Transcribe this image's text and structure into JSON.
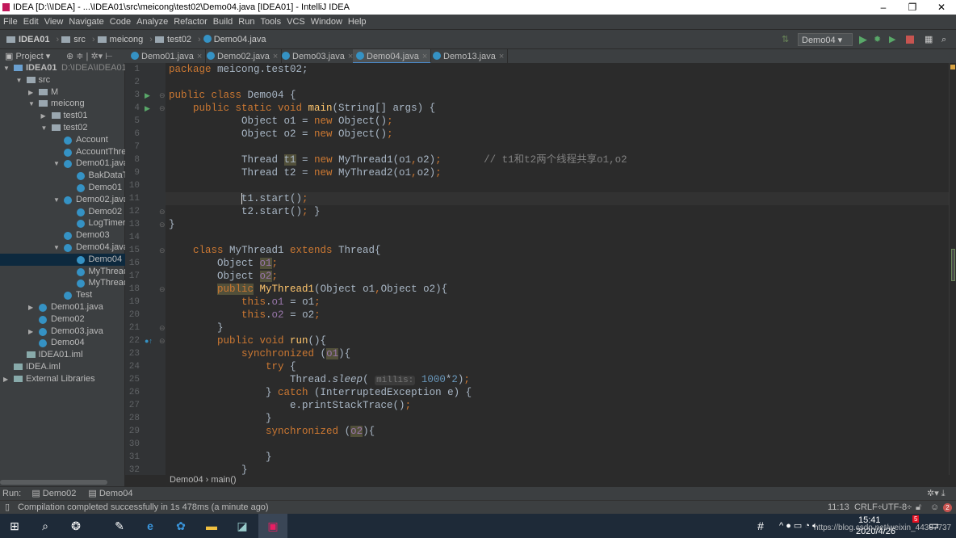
{
  "window": {
    "title": "IDEA [D:\\\\IDEA] - ...\\IDEA01\\src\\meicong\\test02\\Demo04.java [IDEA01] - IntelliJ IDEA"
  },
  "menu": [
    "File",
    "Edit",
    "View",
    "Navigate",
    "Code",
    "Analyze",
    "Refactor",
    "Build",
    "Run",
    "Tools",
    "VCS",
    "Window",
    "Help"
  ],
  "breadcrumb": [
    "IDEA01",
    "src",
    "meicong",
    "test02",
    "Demo04.java"
  ],
  "run_config": "Demo04",
  "project_label": "Project",
  "tabs": [
    {
      "label": "Demo01.java"
    },
    {
      "label": "Demo02.java"
    },
    {
      "label": "Demo03.java"
    },
    {
      "label": "Demo04.java",
      "active": true
    },
    {
      "label": "Demo13.java"
    }
  ],
  "tree": [
    {
      "d": 0,
      "label": "IDEA01",
      "extra": "D:\\IDEA\\IDEA01",
      "arrow": "open",
      "icon": "module"
    },
    {
      "d": 1,
      "label": "src",
      "arrow": "open",
      "icon": "folder"
    },
    {
      "d": 2,
      "label": "M",
      "arrow": "closed",
      "icon": "folder"
    },
    {
      "d": 2,
      "label": "meicong",
      "arrow": "open",
      "icon": "folder"
    },
    {
      "d": 3,
      "label": "test01",
      "arrow": "closed",
      "icon": "folder"
    },
    {
      "d": 3,
      "label": "test02",
      "arrow": "open",
      "icon": "folder"
    },
    {
      "d": 4,
      "label": "Account",
      "icon": "class"
    },
    {
      "d": 4,
      "label": "AccountThrea",
      "icon": "class"
    },
    {
      "d": 4,
      "label": "Demo01.java",
      "arrow": "open",
      "icon": "class"
    },
    {
      "d": 5,
      "label": "BakDataTh",
      "icon": "class"
    },
    {
      "d": 5,
      "label": "Demo01",
      "icon": "class"
    },
    {
      "d": 4,
      "label": "Demo02.java",
      "arrow": "open",
      "icon": "class"
    },
    {
      "d": 5,
      "label": "Demo02",
      "icon": "class"
    },
    {
      "d": 5,
      "label": "LogTimer",
      "icon": "class"
    },
    {
      "d": 4,
      "label": "Demo03",
      "icon": "class"
    },
    {
      "d": 4,
      "label": "Demo04.java",
      "arrow": "open",
      "icon": "class"
    },
    {
      "d": 5,
      "label": "Demo04",
      "icon": "class",
      "selected": true
    },
    {
      "d": 5,
      "label": "MyThread",
      "icon": "class"
    },
    {
      "d": 5,
      "label": "MyThread",
      "icon": "class"
    },
    {
      "d": 4,
      "label": "Test",
      "icon": "class"
    },
    {
      "d": 2,
      "label": "Demo01.java",
      "arrow": "closed",
      "icon": "class"
    },
    {
      "d": 2,
      "label": "Demo02",
      "icon": "class"
    },
    {
      "d": 2,
      "label": "Demo03.java",
      "arrow": "closed",
      "icon": "class"
    },
    {
      "d": 2,
      "label": "Demo04",
      "icon": "class"
    },
    {
      "d": 1,
      "label": "IDEA01.iml",
      "icon": "file"
    },
    {
      "d": 0,
      "label": "IDEA.iml",
      "icon": "file"
    },
    {
      "d": 0,
      "label": "External Libraries",
      "arrow": "closed",
      "icon": "library"
    }
  ],
  "code": [
    [
      [
        "package ",
        "kw"
      ],
      [
        "meicong.test02;",
        ""
      ]
    ],
    [],
    [
      [
        "public class ",
        "kw"
      ],
      [
        "Demo04 {",
        ""
      ]
    ],
    [
      [
        "    public static void ",
        "kw"
      ],
      [
        "main",
        "fn"
      ],
      [
        "(String[] args) {",
        ""
      ]
    ],
    [
      [
        "            Object o1 = ",
        ""
      ],
      [
        "new ",
        "kw"
      ],
      [
        "Object()",
        ""
      ],
      [
        ";",
        "kw"
      ]
    ],
    [
      [
        "            Object o2 = ",
        ""
      ],
      [
        "new ",
        "kw"
      ],
      [
        "Object()",
        ""
      ],
      [
        ";",
        "kw"
      ]
    ],
    [],
    [
      [
        "            Thread ",
        ""
      ],
      [
        "t1",
        "hl"
      ],
      [
        " = ",
        ""
      ],
      [
        "new ",
        "kw"
      ],
      [
        "MyThread1(o1",
        ""
      ],
      [
        ",",
        "kw"
      ],
      [
        "o2)",
        ""
      ],
      [
        ";",
        "kw"
      ],
      [
        "       // t1和t2两个线程共享o1,o2",
        "cm"
      ]
    ],
    [
      [
        "            Thread t2 = ",
        ""
      ],
      [
        "new ",
        "kw"
      ],
      [
        "MyThread2(o1",
        ""
      ],
      [
        ",",
        "kw"
      ],
      [
        "o2)",
        ""
      ],
      [
        ";",
        "kw"
      ]
    ],
    [],
    [
      [
        "            t1.start()",
        ""
      ],
      [
        ";",
        "kw"
      ]
    ],
    [
      [
        "            t2.start()",
        ""
      ],
      [
        ";",
        "kw"
      ],
      [
        " }",
        ""
      ]
    ],
    [
      [
        "}",
        ""
      ]
    ],
    [],
    [
      [
        "    class ",
        "kw"
      ],
      [
        "MyThread1 ",
        ""
      ],
      [
        "extends ",
        "kw"
      ],
      [
        "Thread{",
        ""
      ]
    ],
    [
      [
        "        Object ",
        ""
      ],
      [
        "o1",
        "fld hl"
      ],
      [
        ";",
        "kw"
      ]
    ],
    [
      [
        "        Object ",
        ""
      ],
      [
        "o2",
        "fld hl"
      ],
      [
        ";",
        "kw"
      ]
    ],
    [
      [
        "        ",
        ""
      ],
      [
        "public",
        "kw hl"
      ],
      [
        " ",
        ""
      ],
      [
        "MyThread1",
        "fn"
      ],
      [
        "(Object o1",
        ""
      ],
      [
        ",",
        "kw"
      ],
      [
        "Object o2){",
        ""
      ]
    ],
    [
      [
        "            ",
        ""
      ],
      [
        "this",
        "kw"
      ],
      [
        ".",
        ""
      ],
      [
        "o1",
        "fld"
      ],
      [
        " = o1",
        ""
      ],
      [
        ";",
        "kw"
      ]
    ],
    [
      [
        "            ",
        ""
      ],
      [
        "this",
        "kw"
      ],
      [
        ".",
        ""
      ],
      [
        "o2",
        "fld"
      ],
      [
        " = o2",
        ""
      ],
      [
        ";",
        "kw"
      ]
    ],
    [
      [
        "        }",
        ""
      ]
    ],
    [
      [
        "        ",
        ""
      ],
      [
        "public void ",
        "kw"
      ],
      [
        "run",
        "fn"
      ],
      [
        "(){",
        ""
      ]
    ],
    [
      [
        "            ",
        ""
      ],
      [
        "synchronized ",
        "kw"
      ],
      [
        "(",
        ""
      ],
      [
        "o1",
        "fld hl"
      ],
      [
        "){",
        ""
      ]
    ],
    [
      [
        "                ",
        ""
      ],
      [
        "try ",
        "kw"
      ],
      [
        "{",
        ""
      ]
    ],
    [
      [
        "                    Thread.",
        ""
      ],
      [
        "sleep",
        "it"
      ],
      [
        "( ",
        ""
      ],
      [
        "millis:",
        "hint"
      ],
      [
        " ",
        ""
      ],
      [
        "1000",
        "num"
      ],
      [
        "*",
        ""
      ],
      [
        "2",
        "num"
      ],
      [
        ")",
        ""
      ],
      [
        ";",
        "kw"
      ]
    ],
    [
      [
        "                } ",
        ""
      ],
      [
        "catch ",
        "kw"
      ],
      [
        "(InterruptedException e) {",
        ""
      ]
    ],
    [
      [
        "                    e.printStackTrace()",
        ""
      ],
      [
        ";",
        "kw"
      ]
    ],
    [
      [
        "                }",
        ""
      ]
    ],
    [
      [
        "                ",
        ""
      ],
      [
        "synchronized ",
        "kw"
      ],
      [
        "(",
        ""
      ],
      [
        "o2",
        "fld hl"
      ],
      [
        "){",
        ""
      ]
    ],
    [],
    [
      [
        "                }",
        ""
      ]
    ],
    [
      [
        "            }",
        ""
      ]
    ]
  ],
  "editor_breadcrumb": [
    "Demo04",
    "main()"
  ],
  "run": {
    "label": "Run:",
    "tabs": [
      "Demo02",
      "Demo04"
    ]
  },
  "status": {
    "message": "Compilation completed successfully in 1s 478ms (a minute ago)",
    "position": "11:13",
    "line_sep": "CRLF",
    "encoding": "UTF-8",
    "notifications": "2"
  },
  "taskbar": {
    "time": "15:41",
    "date": "2020/4/26",
    "badge": "5",
    "watermark": "https://blog.csdn.net/weixin_44387737"
  }
}
